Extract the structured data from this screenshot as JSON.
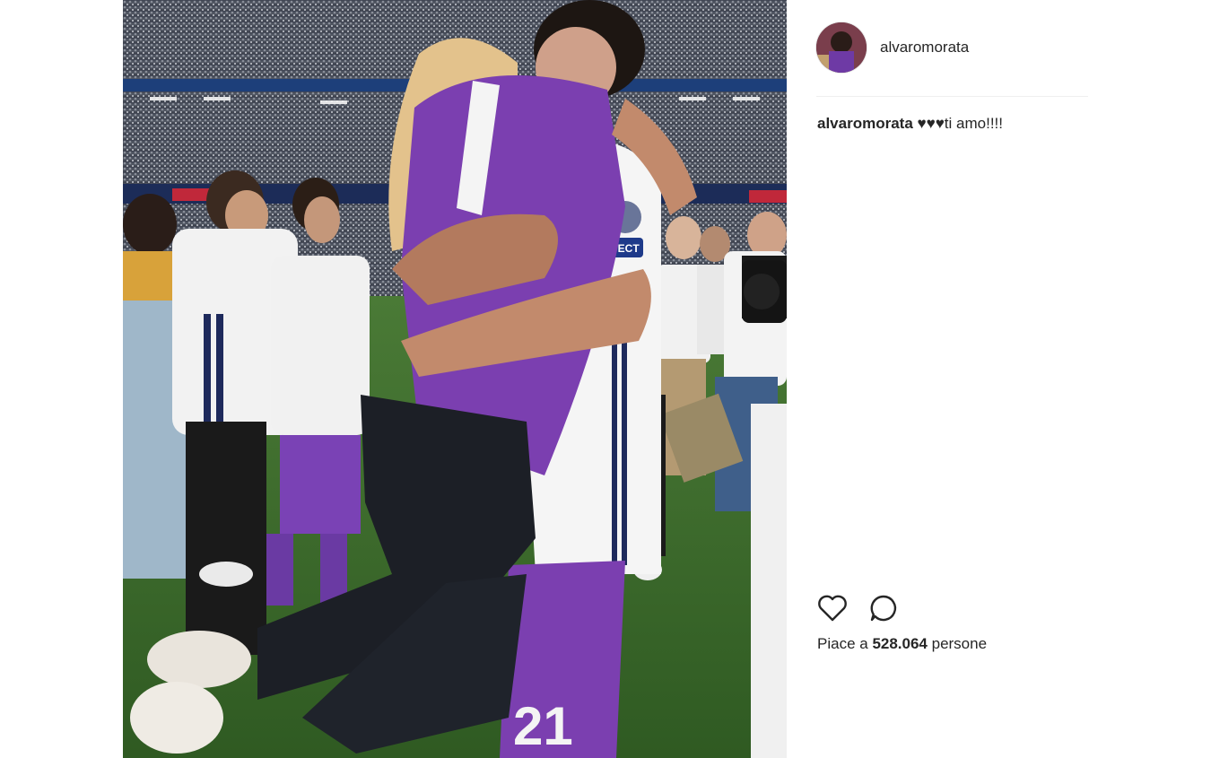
{
  "post": {
    "username": "alvaromorata",
    "caption_user": "alvaromorata",
    "caption_text": "♥♥♥ti amo!!!!",
    "likes_prefix": "Piace a ",
    "likes_count": "528.064",
    "likes_suffix": " persone",
    "photo_jersey_number": "21",
    "photo_sleeve_patch": "RESPECT"
  },
  "icons": {
    "like": "heart-outline-icon",
    "comment": "comment-bubble-icon"
  },
  "colors": {
    "text": "#262626",
    "divider": "#efefef",
    "jersey_purple": "#7b3fb0",
    "pitch_green": "#3f6b2e"
  }
}
